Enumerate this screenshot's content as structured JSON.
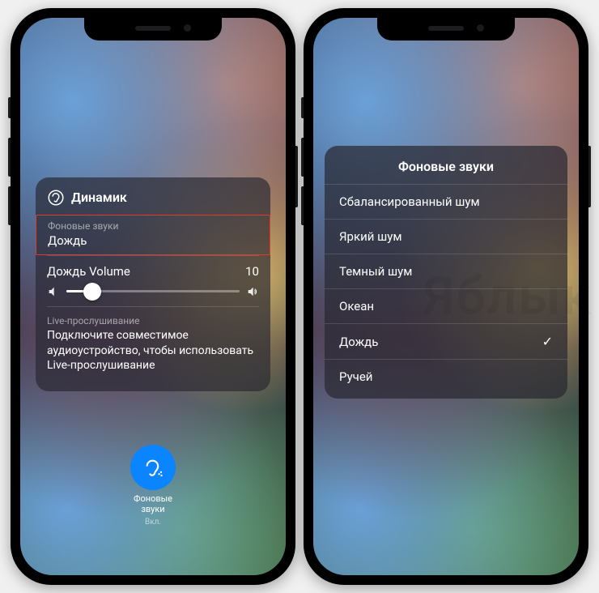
{
  "watermark": "Яблык",
  "phone1": {
    "panel": {
      "header": "Динамик",
      "bgSoundsLabel": "Фоновые звуки",
      "bgSoundsValue": "Дождь",
      "volumeLabel": "Дождь Volume",
      "volumeValue": "10",
      "volumePercent": 15,
      "liveLabel": "Live-прослушивание",
      "liveText": "Подключите совместимое аудиоустройство, чтобы использовать Live-прослушивание"
    },
    "tile": {
      "label": "Фоновые\nзвуки",
      "state": "Вкл."
    }
  },
  "phone2": {
    "title": "Фоновые звуки",
    "items": [
      {
        "label": "Сбалансированный шум",
        "selected": false
      },
      {
        "label": "Яркий шум",
        "selected": false
      },
      {
        "label": "Темный шум",
        "selected": false
      },
      {
        "label": "Океан",
        "selected": false
      },
      {
        "label": "Дождь",
        "selected": true
      },
      {
        "label": "Ручей",
        "selected": false
      }
    ]
  }
}
